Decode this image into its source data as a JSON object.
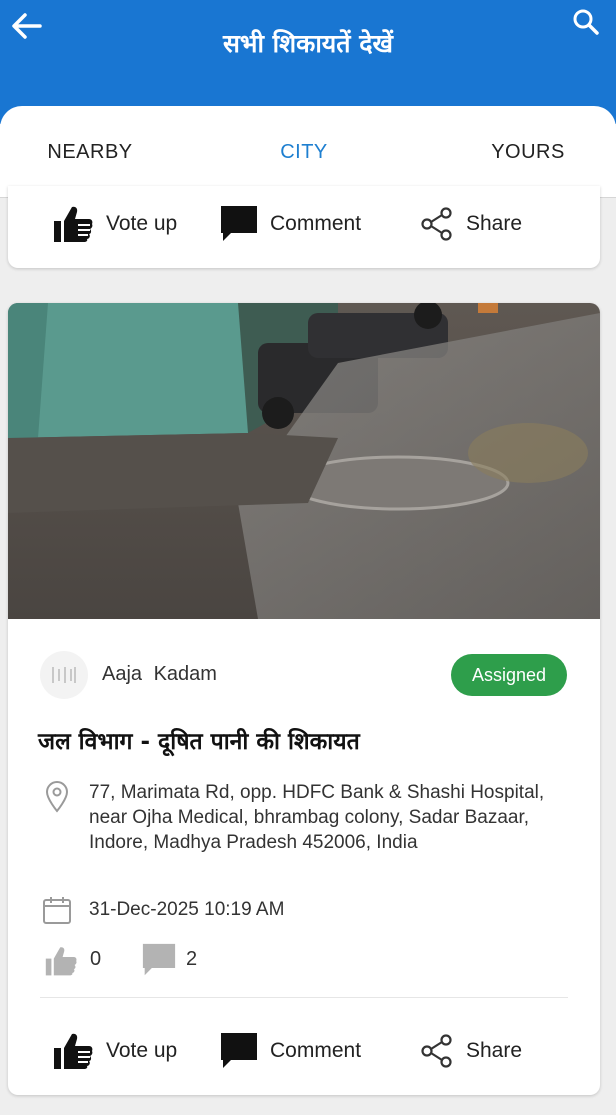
{
  "header": {
    "title": "सभी शिकायतें देखें",
    "back_icon": "arrow-left-icon",
    "search_icon": "search-icon",
    "bg_color": "#1976d2"
  },
  "tabs": [
    {
      "label": "NEARBY",
      "active": false
    },
    {
      "label": "CITY",
      "active": true
    },
    {
      "label": "YOURS",
      "active": false
    }
  ],
  "actions": {
    "vote_up": "Vote up",
    "comment": "Comment",
    "share": "Share"
  },
  "complaint": {
    "author": "Aaja Kadam",
    "status": "Assigned",
    "status_color": "#2e9e4b",
    "title": "जल विभाग - दूषित पानी की शिकायत",
    "address": "77, Marimata Rd, opp. HDFC Bank & Shashi Hospital, near Ojha Medical, bhrambag colony, Sadar Bazaar, Indore, Madhya Pradesh 452006, India",
    "datetime": "31-Dec-2025 10:19 AM",
    "upvotes": "0",
    "comments": "2",
    "photo": "waterlogged-street-photo"
  }
}
